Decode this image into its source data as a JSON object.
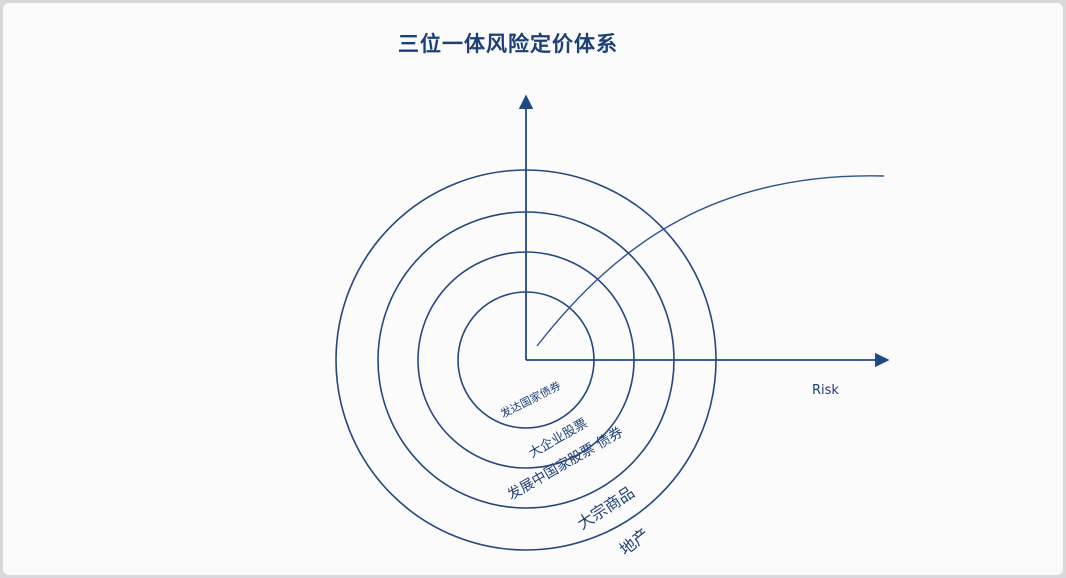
{
  "title": "三位一体风险定价体系",
  "axis": {
    "x_label": "Risk",
    "y_label": ""
  },
  "rings": [
    {
      "label": "发达国家债券"
    },
    {
      "label": "大企业股票"
    },
    {
      "label": "发展中国家股票 债券"
    },
    {
      "label": "大宗商品"
    },
    {
      "label": "地产"
    }
  ],
  "colors": {
    "primary": "#1f3f76",
    "background": "#fbfbfb"
  }
}
